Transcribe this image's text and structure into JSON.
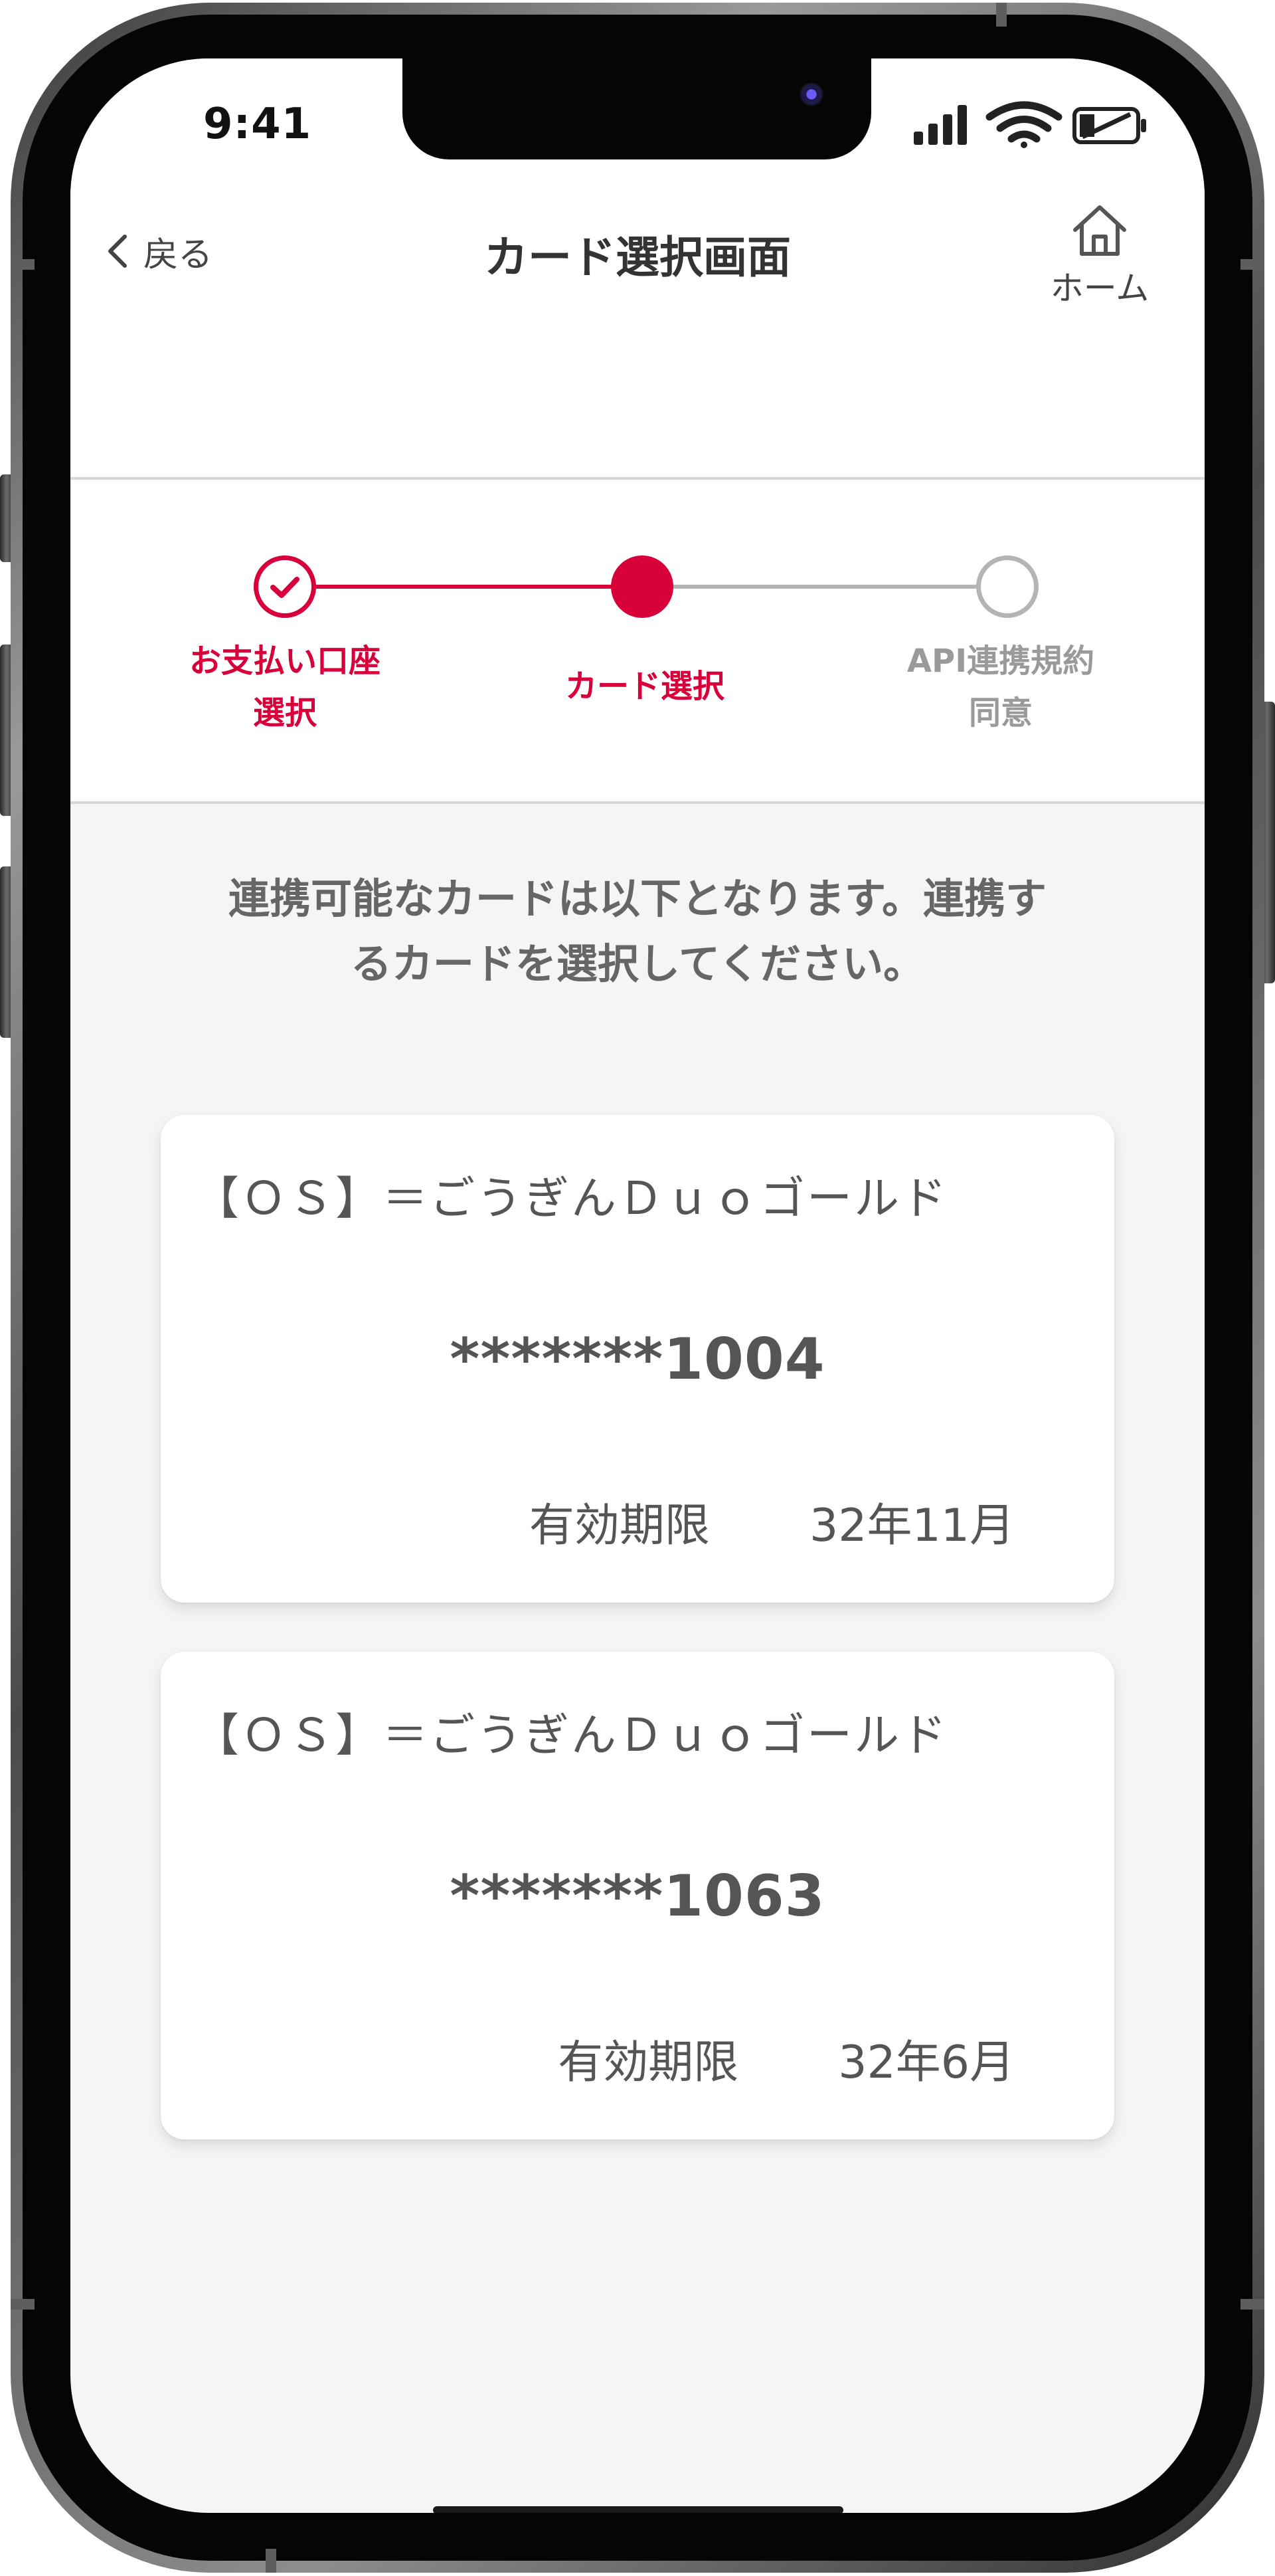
{
  "status_bar": {
    "time": "9:41",
    "icons": [
      "cellular-signal-icon",
      "wifi-icon",
      "battery-icon"
    ]
  },
  "header": {
    "back_label": "戻る",
    "title": "カード選択画面",
    "home_label": "ホーム"
  },
  "stepper": {
    "steps": [
      {
        "line1": "お支払い口座",
        "line2": "選択",
        "state": "completed"
      },
      {
        "line1": "カード選択",
        "line2": "",
        "state": "current"
      },
      {
        "line1": "API連携規約",
        "line2": "同意",
        "state": "pending"
      }
    ]
  },
  "main": {
    "instruction_line1": "連携可能なカードは以下となります。連携す",
    "instruction_line2": "るカードを選択してください。",
    "cards": [
      {
        "name": "【ＯＳ】＝ごうぎんＤｕｏゴールド",
        "number": "*******1004",
        "expiry_label": "有効期限",
        "expiry_value": "32年11月"
      },
      {
        "name": "【ＯＳ】＝ごうぎんＤｕｏゴールド",
        "number": "*******1063",
        "expiry_label": "有効期限",
        "expiry_value": "32年6月"
      }
    ]
  },
  "colors": {
    "accent": "#d8003a",
    "inactive": "#9a9a9a",
    "background": "#f5f5f5",
    "text": "#555555"
  }
}
